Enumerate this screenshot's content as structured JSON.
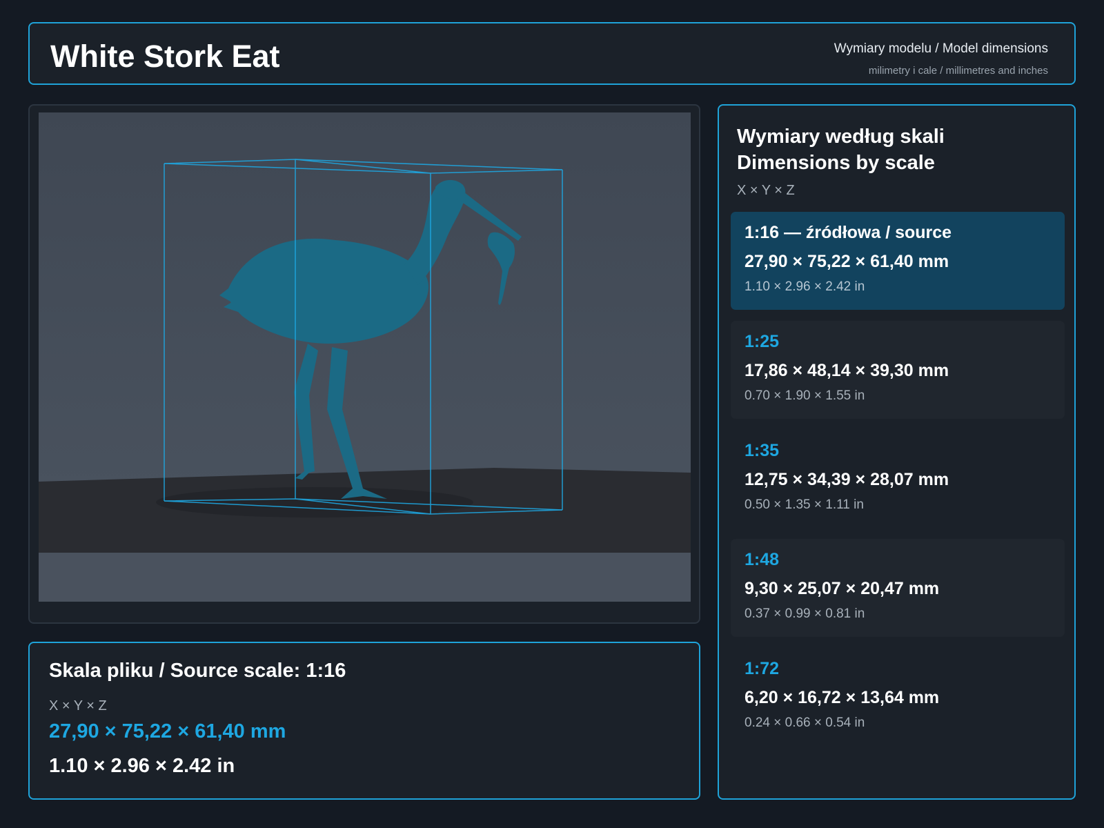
{
  "header": {
    "title": "White Stork Eat",
    "dims_title": "Wymiary modelu / Model dimensions",
    "dims_subtitle": "milimetry i cale / millimetres and inches"
  },
  "viewer": {
    "subject": "white-stork-eating-model",
    "model_color": "#1b6a85",
    "bbox_color": "#1ea7e1"
  },
  "source_info": {
    "scale_line": "Skala pliku / Source scale: 1:16",
    "axes_label": "X × Y × Z",
    "mm": "27,90 × 75,22 × 61,40 mm",
    "in": "1.10 × 2.96 × 2.42 in"
  },
  "scales_panel": {
    "title_line1": "Wymiary według skali",
    "title_line2": "Dimensions by scale",
    "axes_label": "X × Y × Z",
    "items": [
      {
        "label": "1:16  —  źródłowa / source",
        "mm": "27,90 × 75,22 × 61,40 mm",
        "in": "1.10 × 2.96 × 2.42 in"
      },
      {
        "label": "1:25",
        "mm": "17,86 × 48,14 × 39,30 mm",
        "in": "0.70 × 1.90 × 1.55 in"
      },
      {
        "label": "1:35",
        "mm": "12,75 × 34,39 × 28,07 mm",
        "in": "0.50 × 1.35 × 1.11 in"
      },
      {
        "label": "1:48",
        "mm": "9,30 × 25,07 × 20,47 mm",
        "in": "0.37 × 0.99 × 0.81 in"
      },
      {
        "label": "1:72",
        "mm": "6,20 × 16,72 × 13,64 mm",
        "in": "0.24 × 0.66 × 0.54 in"
      }
    ]
  },
  "colors": {
    "accent": "#1ea7e1",
    "background": "#141a23",
    "card": "#1b2129",
    "active_card": "#12435e"
  }
}
